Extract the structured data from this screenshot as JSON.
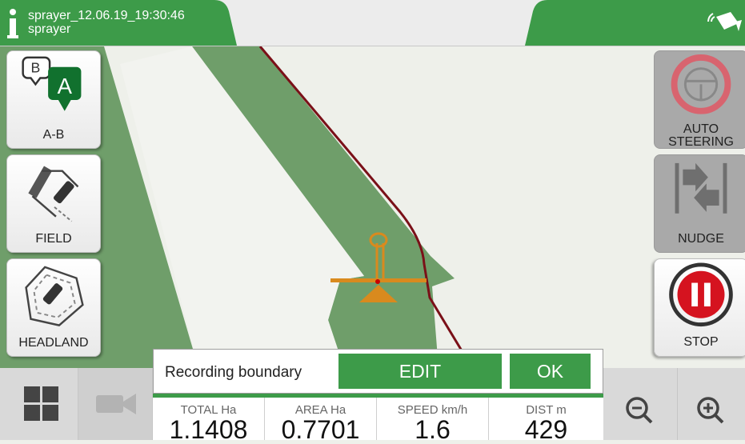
{
  "header": {
    "info_icon": "info-icon",
    "session_name": "sprayer_12.06.19_19:30:46",
    "implement": "sprayer",
    "gps_icon": "gps-signal-icon"
  },
  "left_menu": [
    {
      "label": "A-B",
      "icon": "ab-line-icon"
    },
    {
      "label": "FIELD",
      "icon": "field-boundary-icon"
    },
    {
      "label": "HEADLAND",
      "icon": "headland-icon"
    }
  ],
  "ab_icon_letters": {
    "a": "A",
    "b": "B"
  },
  "right_menu": {
    "auto_steering": {
      "line1": "AUTO",
      "line2": "STEERING",
      "icon": "steering-wheel-icon"
    },
    "nudge": {
      "label": "NUDGE",
      "icon": "nudge-icon"
    },
    "stop": {
      "label": "STOP",
      "icon": "pause-icon"
    }
  },
  "bottom_bar": {
    "layout_icon": "grid-layout-icon",
    "camera_icon": "camera-icon",
    "zoom_out_icon": "zoom-out-icon",
    "zoom_in_icon": "zoom-in-icon"
  },
  "popup": {
    "message": "Recording boundary",
    "edit_label": "EDIT",
    "ok_label": "OK"
  },
  "stats": [
    {
      "label": "TOTAL Ha",
      "value": "1.1408"
    },
    {
      "label": "AREA Ha",
      "value": "0.7701"
    },
    {
      "label": "SPEED km/h",
      "value": "1.6"
    },
    {
      "label": "DIST m",
      "value": "429"
    }
  ],
  "colors": {
    "accent_green": "#3d9b49",
    "map_green": "#6f9e6a",
    "boundary_red": "#7a1018",
    "vehicle_orange": "#d98a1e",
    "stop_red": "#d5131f"
  }
}
